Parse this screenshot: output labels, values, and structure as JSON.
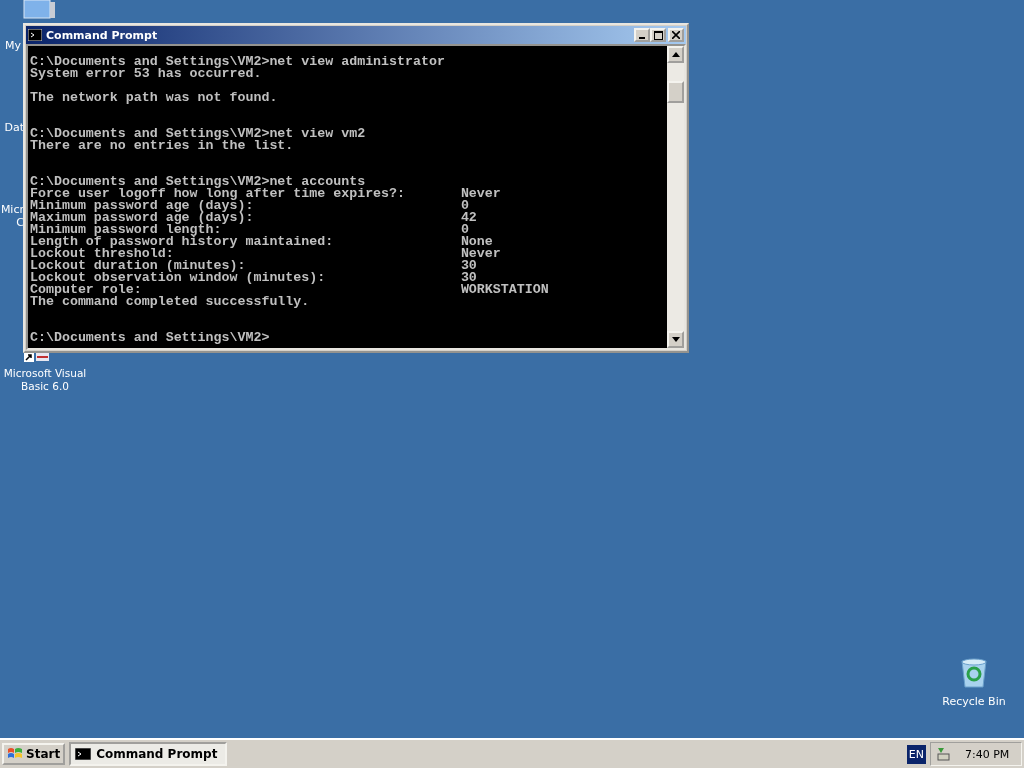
{
  "desktop_icons": [
    {
      "kind": "computer",
      "label_lines": [
        "My"
      ]
    },
    {
      "kind": "database",
      "label_lines": [
        "Dat"
      ]
    },
    {
      "kind": "app",
      "label_lines": [
        "Micr",
        "C"
      ]
    },
    {
      "kind": "vb",
      "label_lines": [
        "Microsoft Visual",
        "Basic 6.0"
      ]
    },
    {
      "kind": "recycle",
      "label_lines": [
        "Recycle Bin"
      ]
    }
  ],
  "window": {
    "title": "Command Prompt",
    "active": true,
    "console_lines": [
      {
        "kind": "text",
        "text": "C:\\Documents and Settings\\VM2>net view administrator"
      },
      {
        "kind": "text",
        "text": "System error 53 has occurred."
      },
      {
        "kind": "blank"
      },
      {
        "kind": "text",
        "text": "The network path was not found."
      },
      {
        "kind": "blank"
      },
      {
        "kind": "blank"
      },
      {
        "kind": "text",
        "text": "C:\\Documents and Settings\\VM2>net view vm2"
      },
      {
        "kind": "text",
        "text": "There are no entries in the list."
      },
      {
        "kind": "blank"
      },
      {
        "kind": "blank"
      },
      {
        "kind": "text",
        "text": "C:\\Documents and Settings\\VM2>net accounts"
      },
      {
        "kind": "text",
        "text": "Force user logoff how long after time expires?:       Never"
      },
      {
        "kind": "text",
        "text": "Minimum password age (days):                          0"
      },
      {
        "kind": "text",
        "text": "Maximum password age (days):                          42"
      },
      {
        "kind": "text",
        "text": "Minimum password length:                              0"
      },
      {
        "kind": "text",
        "text": "Length of password history maintained:                None"
      },
      {
        "kind": "text",
        "text": "Lockout threshold:                                    Never"
      },
      {
        "kind": "text",
        "text": "Lockout duration (minutes):                           30"
      },
      {
        "kind": "text",
        "text": "Lockout observation window (minutes):                 30"
      },
      {
        "kind": "text",
        "text": "Computer role:                                        WORKSTATION"
      },
      {
        "kind": "text",
        "text": "The command completed successfully."
      },
      {
        "kind": "blank"
      },
      {
        "kind": "blank"
      },
      {
        "kind": "text",
        "text": "C:\\Documents and Settings\\VM2>"
      }
    ]
  },
  "taskbar": {
    "start_label": "Start",
    "tasks": [
      {
        "label": "Command Prompt",
        "selected": true
      }
    ],
    "language": "EN",
    "clock": "7:40 PM"
  }
}
